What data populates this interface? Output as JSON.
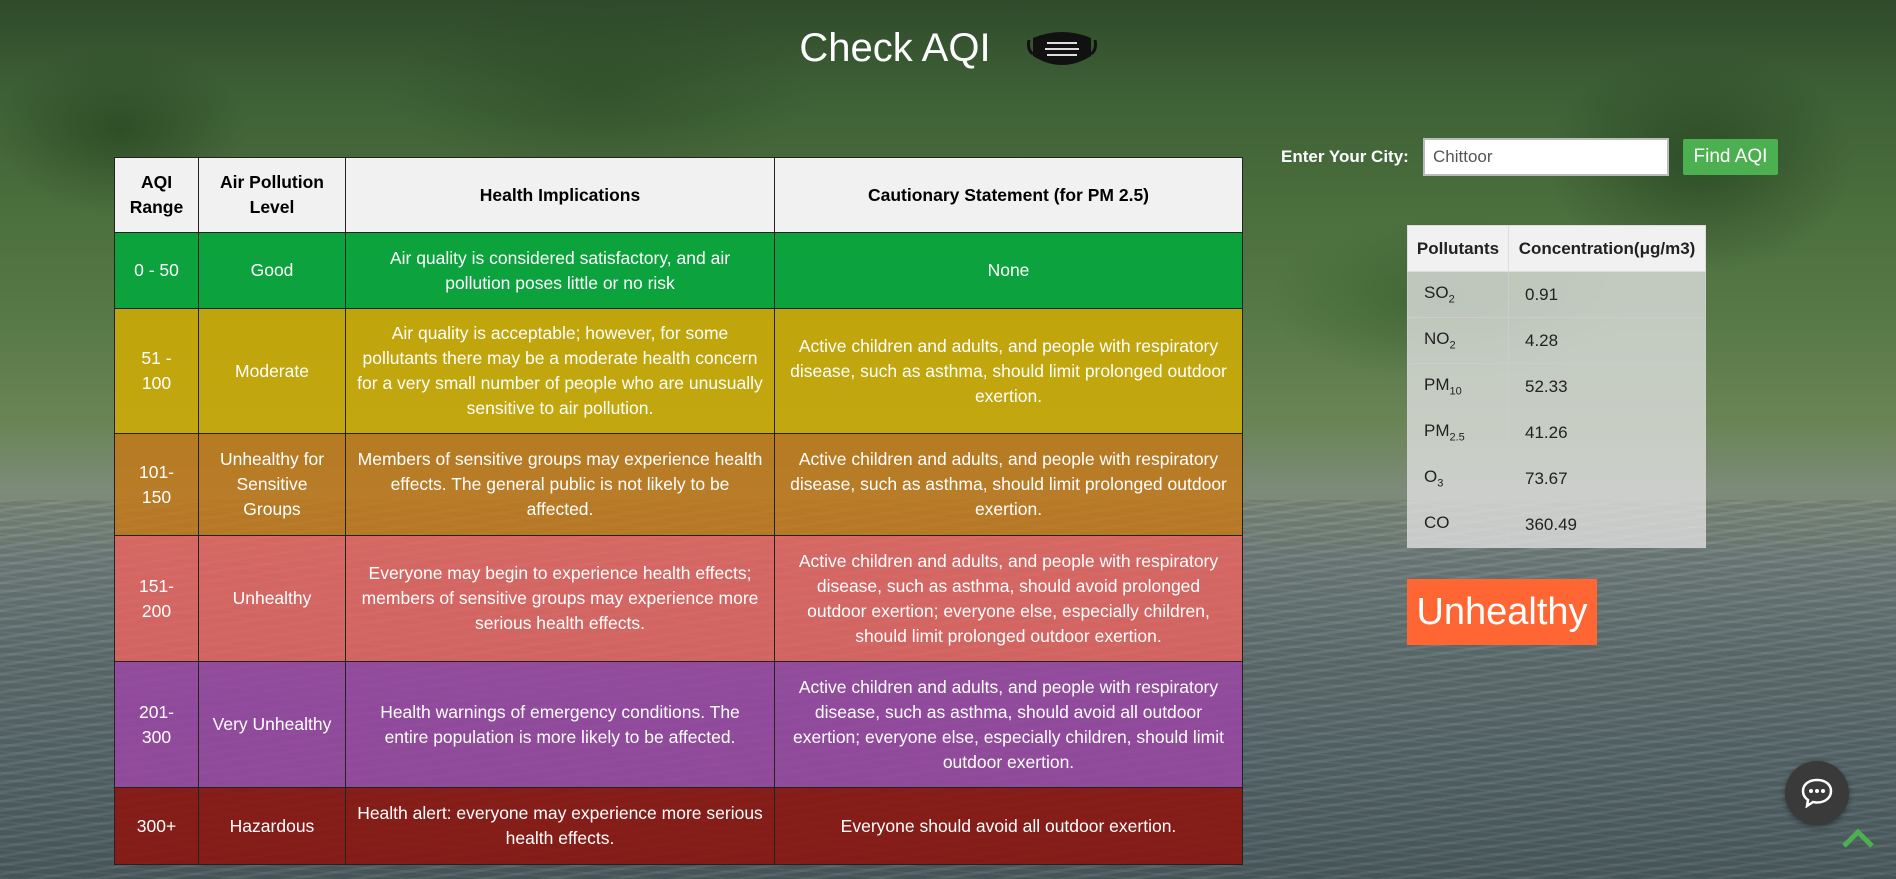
{
  "header": {
    "title": "Check AQI",
    "icon": "mask-icon"
  },
  "aqi_table": {
    "headers": [
      "AQI Range",
      "Air Pollution Level",
      "Health Implications",
      "Cautionary Statement (for PM 2.5)"
    ],
    "rows": [
      {
        "range": "0 - 50",
        "level": "Good",
        "health": "Air quality is considered satisfactory, and air pollution poses little or no risk",
        "caution": "None",
        "color": "#00aa3c"
      },
      {
        "range": "51 - 100",
        "level": "Moderate",
        "health": "Air quality is acceptable; however, for some pollutants there may be a moderate health concern for a very small number of people who are unusually sensitive to air pollution.",
        "caution": "Active children and adults, and people with respiratory disease, such as asthma, should limit prolonged outdoor exertion.",
        "color": "#d7af00"
      },
      {
        "range": "101-150",
        "level": "Unhealthy for Sensitive Groups",
        "health": "Members of sensitive groups may experience health effects. The general public is not likely to be affected.",
        "caution": "Active children and adults, and people with respiratory disease, such as asthma, should limit prolonged outdoor exertion.",
        "color": "#c87814"
      },
      {
        "range": "151-200",
        "level": "Unhealthy",
        "health": "Everyone may begin to experience health effects; members of sensitive groups may experience more serious health effects.",
        "caution": "Active children and adults, and people with respiratory disease, such as asthma, should avoid prolonged outdoor exertion; everyone else, especially children, should limit prolonged outdoor exertion.",
        "color": "#eb645f"
      },
      {
        "range": "201-300",
        "level": "Very Unhealthy",
        "health": "Health warnings of emergency conditions. The entire population is more likely to be affected.",
        "caution": "Active children and adults, and people with respiratory disease, such as asthma, should avoid all outdoor exertion; everyone else, especially children, should limit outdoor exertion.",
        "color": "#9b46a5"
      },
      {
        "range": "300+",
        "level": "Hazardous",
        "health": "Health alert: everyone may experience more serious health effects.",
        "caution": "Everyone should avoid all outdoor exertion.",
        "color": "#8c140f"
      }
    ]
  },
  "search": {
    "label": "Enter Your City:",
    "value": "Chittoor",
    "button": "Find AQI"
  },
  "pollutants": {
    "headers": [
      "Pollutants",
      "Concentration(μg/m3)"
    ],
    "rows": [
      {
        "base": "SO",
        "sub": "2",
        "value": "0.91"
      },
      {
        "base": "NO",
        "sub": "2",
        "value": "4.28"
      },
      {
        "base": "PM",
        "sub": "10",
        "value": "52.33"
      },
      {
        "base": "PM",
        "sub": "2.5",
        "value": "41.26"
      },
      {
        "base": "O",
        "sub": "3",
        "value": "73.67"
      },
      {
        "base": "CO",
        "sub": "",
        "value": "360.49"
      }
    ]
  },
  "status": {
    "label": "Unhealthy",
    "color": "#ff6633"
  },
  "widgets": {
    "chat_icon": "chat-icon",
    "top_icon": "chevron-up-icon"
  }
}
